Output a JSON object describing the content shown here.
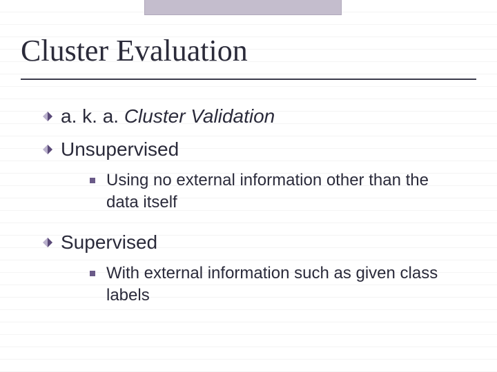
{
  "title": "Cluster Evaluation",
  "icons": {
    "diamond": "diamond-bullet-icon",
    "square": "square-bullet-icon"
  },
  "colors": {
    "diamond_dark": "#5a4a78",
    "diamond_light": "#b9b0cc",
    "square": "#6a5a88",
    "title_rule": "#3a3a4a",
    "topbar": "#c4bdcd"
  },
  "bullets": [
    {
      "prefix": "a. k. a. ",
      "italic": "Cluster Validation",
      "sub": []
    },
    {
      "prefix": "Unsupervised",
      "italic": "",
      "sub": [
        "Using no external information other than the data itself"
      ]
    },
    {
      "prefix": "Supervised",
      "italic": "",
      "sub": [
        "With external information such as given class labels"
      ]
    }
  ]
}
